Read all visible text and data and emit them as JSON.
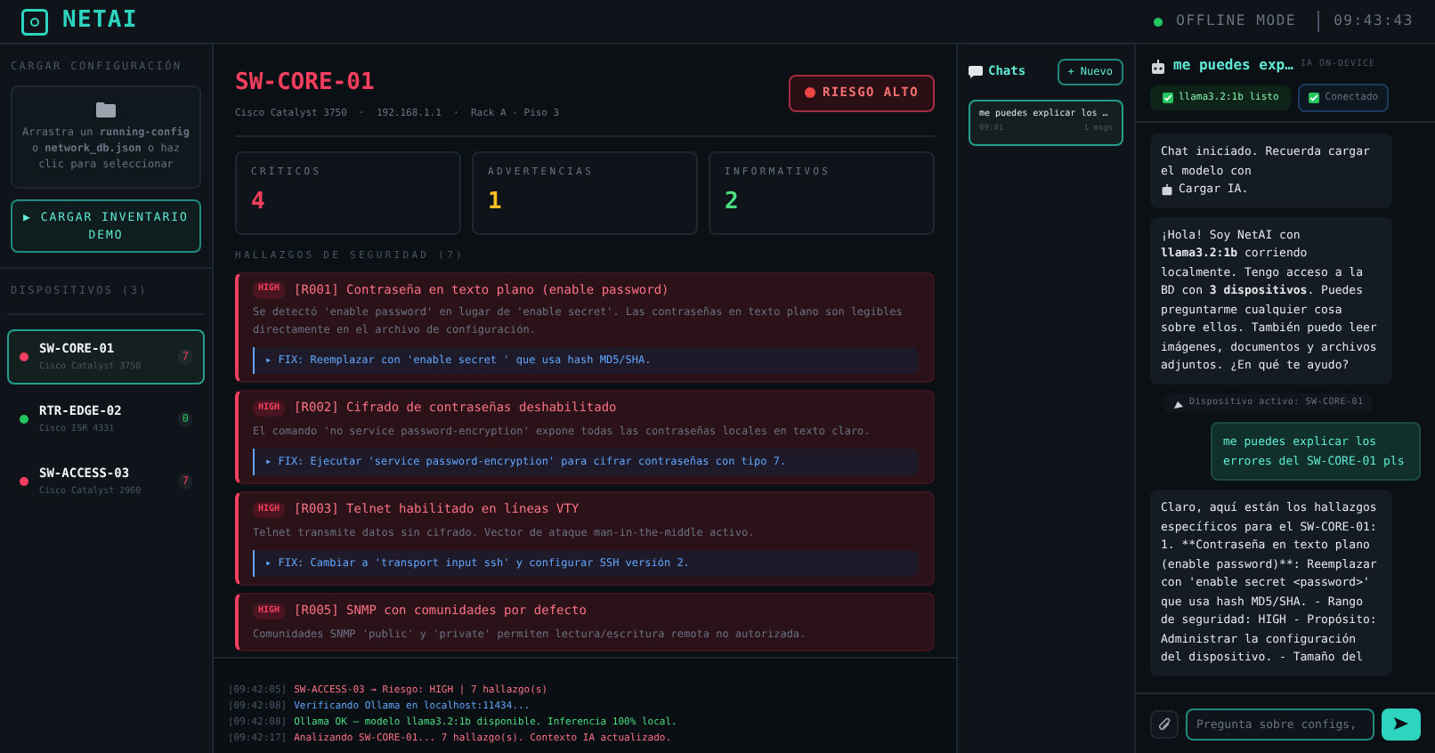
{
  "header": {
    "logo": "NETAI",
    "status": "OFFLINE MODE",
    "time": "09:43:43"
  },
  "sidebar": {
    "upload_title": "CARGAR CONFIGURACIÓN",
    "upload_text": "Arrastra un **running-config** o **network_db.json** o haz clic para seleccionar",
    "demo_button": "▶ CARGAR INVENTARIO DEMO",
    "devices_title": "DISPOSITIVOS (3)",
    "devices": [
      {
        "name": "SW-CORE-01",
        "model": "Cisco Catalyst 3750",
        "count": "7",
        "color": "#f43f5e",
        "selected": true
      },
      {
        "name": "RTR-EDGE-02",
        "model": "Cisco ISR 4331",
        "count": "0",
        "color": "#22c55e",
        "selected": false
      },
      {
        "name": "SW-ACCESS-03",
        "model": "Cisco Catalyst 2960",
        "count": "7",
        "color": "#f43f5e",
        "selected": false
      }
    ]
  },
  "device": {
    "name": "SW-CORE-01",
    "meta": "Cisco Catalyst 3750  ·  192.168.1.1  ·  Rack A - Piso 3",
    "risk_label": "RIESGO ALTO"
  },
  "stats": [
    {
      "label": "CRÍTICOS",
      "value": "4",
      "kind": "critical"
    },
    {
      "label": "ADVERTENCIAS",
      "value": "1",
      "kind": "warning"
    },
    {
      "label": "INFORMATIVOS",
      "value": "2",
      "kind": "info"
    }
  ],
  "findings_title": "HALLAZGOS DE SEGURIDAD (7)",
  "findings": [
    {
      "severity": "HIGH",
      "title": "[R001] Contraseña en texto plano (enable password)",
      "description": "Se detectó 'enable password' en lugar de 'enable secret'. Las contraseñas en texto plano son legibles directamente en el archivo de configuración.",
      "fix": "▸ FIX: Reemplazar con 'enable secret ' que usa hash MD5/SHA."
    },
    {
      "severity": "HIGH",
      "title": "[R002] Cifrado de contraseñas deshabilitado",
      "description": "El comando 'no service password-encryption' expone todas las contraseñas locales en texto claro.",
      "fix": "▸ FIX: Ejecutar 'service password-encryption' para cifrar contraseñas con tipo 7."
    },
    {
      "severity": "HIGH",
      "title": "[R003] Telnet habilitado en líneas VTY",
      "description": "Telnet transmite datos sin cifrado. Vector de ataque man-in-the-middle activo.",
      "fix": "▸ FIX: Cambiar a 'transport input ssh' y configurar SSH versión 2."
    },
    {
      "severity": "HIGH",
      "title": "[R005] SNMP con comunidades por defecto",
      "description": "Comunidades SNMP 'public' y 'private' permiten lectura/escritura remota no autorizada."
    }
  ],
  "log": [
    {
      "time": "[09:42:05]",
      "text": "SW-ACCESS-03 → Riesgo: HIGH | 7 hallazgo(s)",
      "color": "#fb7185"
    },
    {
      "time": "[09:42:08]",
      "text": "Verificando Ollama en localhost:11434...",
      "color": "#60a5fa"
    },
    {
      "time": "[09:42:08]",
      "text": "Ollama OK — modelo llama3.2:1b disponible. Inferencia 100% local.",
      "color": "#4ade80"
    },
    {
      "time": "[09:42:17]",
      "text": "Analizando SW-CORE-01... 7 hallazgo(s). Contexto IA actualizado.",
      "color": "#fb7185"
    }
  ],
  "chats": {
    "title": "Chats",
    "new_button": "+ Nuevo",
    "items": [
      {
        "title": "me puedes explicar los …",
        "time": "09:41",
        "count": "1 msgs",
        "selected": true
      }
    ]
  },
  "chat": {
    "title": "me puedes exp…",
    "subtitle": "IA ON-DEVICE",
    "model_badge": "llama3.2:1b listo",
    "connect_button": "Conectado",
    "messages": [
      {
        "kind": "notice",
        "text": "Chat iniciado. Recuerda cargar el modelo con",
        "action": "Cargar IA."
      },
      {
        "kind": "assistant",
        "text": "¡Hola! Soy NetAI con **llama3.2:1b** corriendo localmente. Tengo acceso a la BD con **3 dispositivos**. Puedes preguntarme cualquier cosa sobre ellos. También puedo leer imágenes, documentos y archivos adjuntos. ¿En qué te ayudo?"
      },
      {
        "kind": "device",
        "text": "Dispositivo activo: SW-CORE-01"
      },
      {
        "kind": "user",
        "text": "me puedes explicar los errores del SW-CORE-01 pls"
      },
      {
        "kind": "reply",
        "text": "Claro, aquí están los hallazgos específicos para el SW-CORE-01: 1. **Contraseña en texto plano (enable password)**: Reemplazar con 'enable secret <password>' que usa hash MD5/SHA. - Rango de seguridad: HIGH - Propósito: Administrar la configuración del dispositivo. - Tamaño del"
      }
    ],
    "input_placeholder": "Pregunta sobre configs,"
  }
}
